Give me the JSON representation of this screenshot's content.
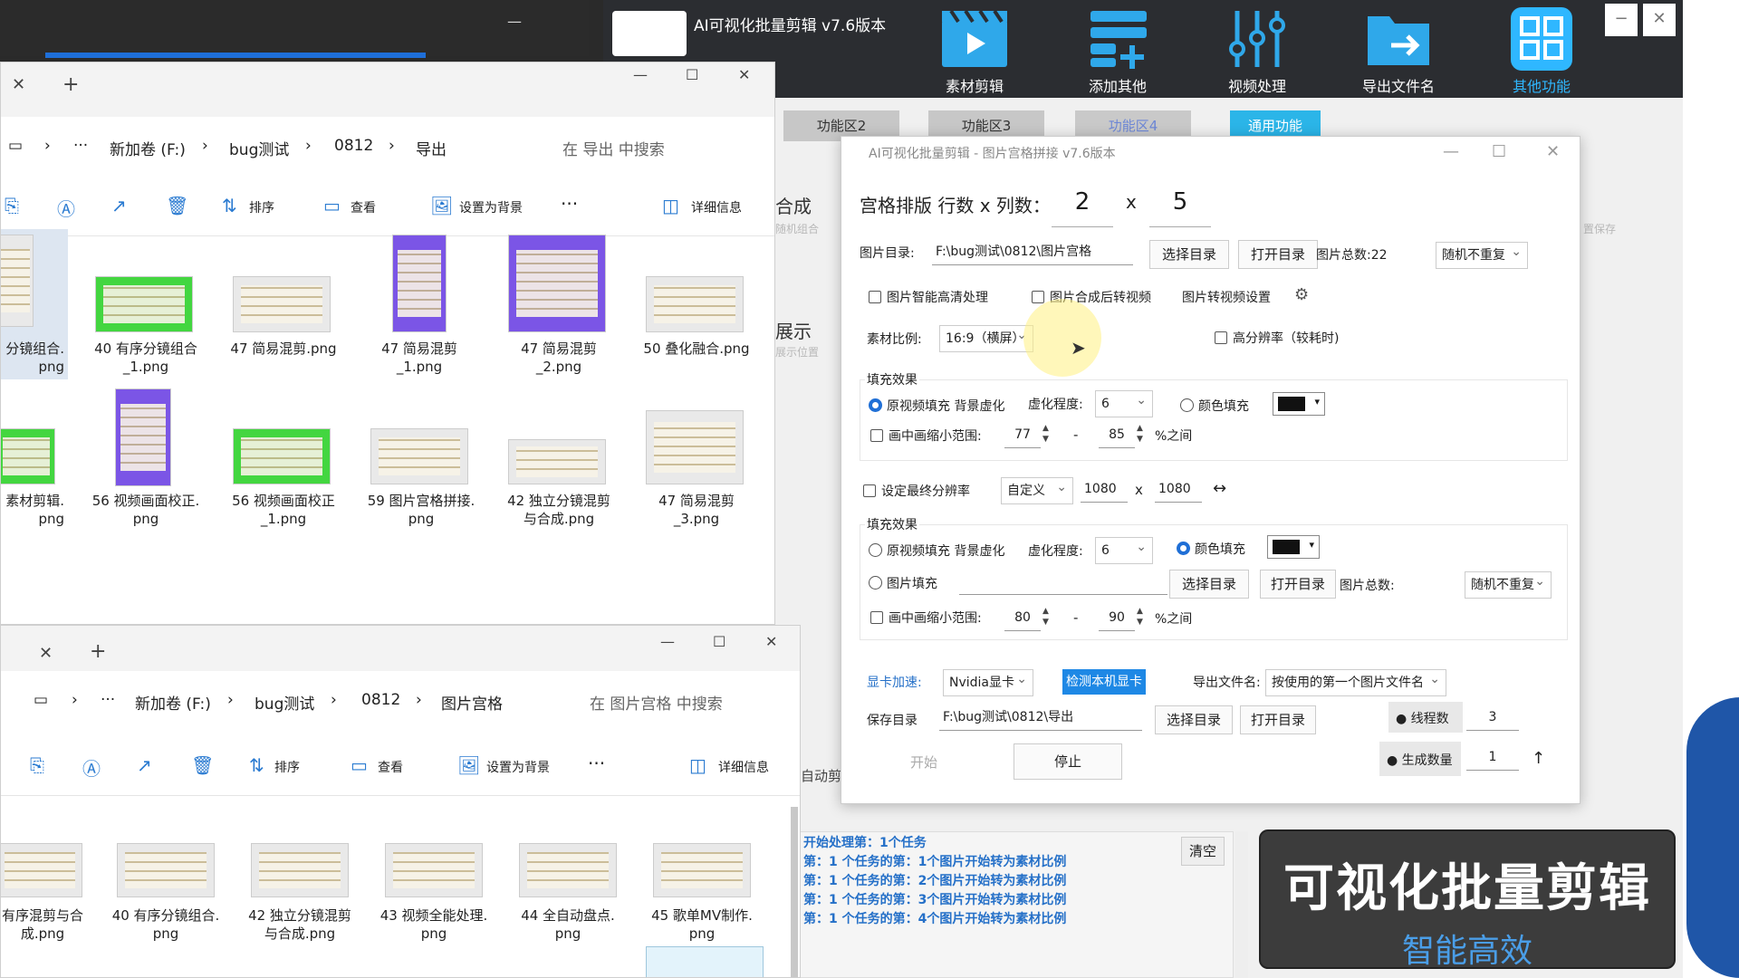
{
  "app": {
    "title": "AI可视化批量剪辑 v7.6版本",
    "toolbar": [
      {
        "label": "素材剪辑",
        "icon": "film-clapper-icon"
      },
      {
        "label": "添加其他",
        "icon": "add-list-icon"
      },
      {
        "label": "视频处理",
        "icon": "sliders-icon"
      },
      {
        "label": "导出文件名",
        "icon": "export-folder-icon"
      },
      {
        "label": "其他功能",
        "icon": "grid-apps-icon"
      }
    ],
    "win_min": "−",
    "win_close": "✕",
    "tabs": [
      "功能区2",
      "功能区3",
      "功能区4",
      "通用功能"
    ],
    "side_labels": [
      "合成",
      "随机组合",
      "展示",
      "展示位置",
      "自动剪",
      "置保存"
    ],
    "log_lines": [
      "开始处理第：1个任务",
      "第：1 个任务的第：1个图片开始转为素材比例",
      "第：1 个任务的第：2个图片开始转为素材比例",
      "第：1 个任务的第：3个图片开始转为素材比例",
      "第：1 个任务的第：4个图片开始转为素材比例"
    ],
    "clear_label": "清空",
    "brand_title": "可视化批量剪辑",
    "brand_sub": "智能高效"
  },
  "explorer_top": {
    "breadcrumb": [
      "新加卷 (F:)",
      "bug测试",
      "0812",
      "导出"
    ],
    "search_placeholder": "在 导出 中搜索",
    "tools": {
      "sort": "排序",
      "view": "查看",
      "set_bg": "设置为背景",
      "more": "···",
      "details": "详细信息"
    },
    "files": [
      {
        "name": "分镜组合.\npng",
        "style": "plain"
      },
      {
        "name": "40 有序分镜组合\n_1.png",
        "style": "green"
      },
      {
        "name": "47 简易混剪.png",
        "style": "plain"
      },
      {
        "name": "47 简易混剪\n_1.png",
        "style": "purple"
      },
      {
        "name": "47 简易混剪\n_2.png",
        "style": "purple"
      },
      {
        "name": "50 叠化融合.png",
        "style": "plain"
      },
      {
        "name": "素材剪辑.\npng",
        "style": "green"
      },
      {
        "name": "56 视频画面校正.\npng",
        "style": "purple"
      },
      {
        "name": "56 视频画面校正\n_1.png",
        "style": "green"
      },
      {
        "name": "59 图片宫格拼接.\npng",
        "style": "plain"
      },
      {
        "name": "42 独立分镜混剪\n与合成.png",
        "style": "plain"
      },
      {
        "name": "47 简易混剪\n_3.png",
        "style": "plain"
      }
    ]
  },
  "explorer_bottom": {
    "breadcrumb": [
      "新加卷 (F:)",
      "bug测试",
      "0812",
      "图片宫格"
    ],
    "search_placeholder": "在 图片宫格 中搜索",
    "tools": {
      "sort": "排序",
      "view": "查看",
      "set_bg": "设置为背景",
      "more": "···",
      "details": "详细信息"
    },
    "files": [
      {
        "name": "有序混剪与合\n成.png"
      },
      {
        "name": "40 有序分镜组合.\npng"
      },
      {
        "name": "42 独立分镜混剪\n与合成.png"
      },
      {
        "name": "43 视频全能处理.\npng"
      },
      {
        "name": "44 全自动盘点.\npng"
      },
      {
        "name": "45 歌单MV制作.\npng"
      }
    ]
  },
  "dialog": {
    "title": "AI可视化批量剪辑 - 图片宫格拼接 v7.6版本",
    "grid_label": "宫格排版 行数 x 列数：",
    "rows": "2",
    "x": "x",
    "cols": "5",
    "img_dir_label": "图片目录:",
    "img_dir": "F:\\bug测试\\0812\\图片宫格",
    "choose_dir": "选择目录",
    "open_dir": "打开目录",
    "img_total": "图片总数:22",
    "random_mode": "随机不重复",
    "cb_hd": "图片智能高清处理",
    "cb_to_video": "图片合成后转视频",
    "to_video_settings": "图片转视频设置",
    "ratio_label": "素材比例:",
    "ratio_value": "16:9（横屏）",
    "cb_hires": "高分辨率（较耗时)",
    "fill1": {
      "title": "填充效果",
      "opt_blur": "原视频填充 背景虚化",
      "blur_label": "虚化程度:",
      "blur_value": "6",
      "opt_color": "颜色填充",
      "shrink_label": "画中画缩小范围:",
      "min": "77",
      "dash": "-",
      "max": "85",
      "suffix": "%之间"
    },
    "final_res_label": "设定最终分辨率",
    "res_mode": "自定义",
    "res_w": "1080",
    "res_x": "x",
    "res_h": "1080",
    "swap_icon": "↔",
    "fill2": {
      "title": "填充效果",
      "opt_blur": "原视频填充 背景虚化",
      "blur_label": "虚化程度:",
      "blur_value": "6",
      "opt_color": "颜色填充",
      "opt_img": "图片填充",
      "choose_dir": "选择目录",
      "open_dir": "打开目录",
      "img_total": "图片总数:",
      "random_mode": "随机不重复",
      "shrink_label": "画中画缩小范围:",
      "min": "80",
      "dash": "-",
      "max": "90",
      "suffix": "%之间"
    },
    "gpu_label": "显卡加速:",
    "gpu_value": "Nvidia显卡",
    "detect_gpu": "检测本机显卡",
    "export_name_label": "导出文件名:",
    "export_name_value": "按使用的第一个图片文件名",
    "save_dir_label": "保存目录",
    "save_dir": "F:\\bug测试\\0812\\导出",
    "choose_dir2": "选择目录",
    "open_dir2": "打开目录",
    "threads_label": "线程数",
    "threads": "3",
    "start": "开始",
    "stop": "停止",
    "gen_count_label": "生成数量",
    "gen_count": "1"
  }
}
